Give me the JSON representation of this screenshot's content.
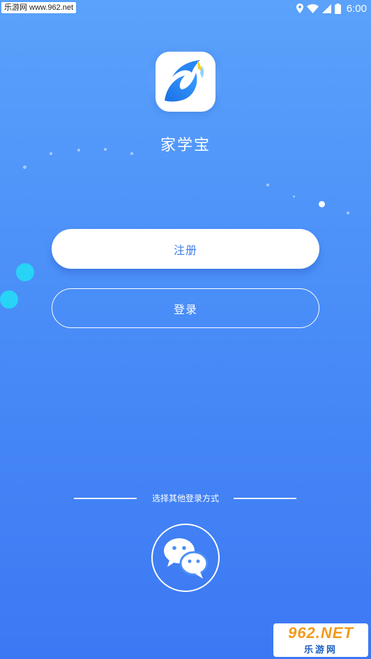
{
  "status_bar": {
    "watermark": "乐游网 www.962.net",
    "time": "6:00",
    "icons": [
      "location-icon",
      "wifi-icon",
      "signal-icon",
      "battery-icon"
    ]
  },
  "app": {
    "title": "家学宝",
    "logo_icon": "leaf-logo-icon"
  },
  "actions": {
    "register_label": "注册",
    "login_label": "登录"
  },
  "other_login": {
    "label": "选择其他登录方式",
    "wechat_icon": "wechat-icon"
  },
  "watermark_bottom": {
    "brand": "962.NET",
    "name": "乐游网"
  },
  "colors": {
    "background_top": "#5aa2fb",
    "background_bottom": "#3c78f3",
    "accent_text": "#3d7cf0",
    "cyan_dot": "#27d4f5"
  }
}
